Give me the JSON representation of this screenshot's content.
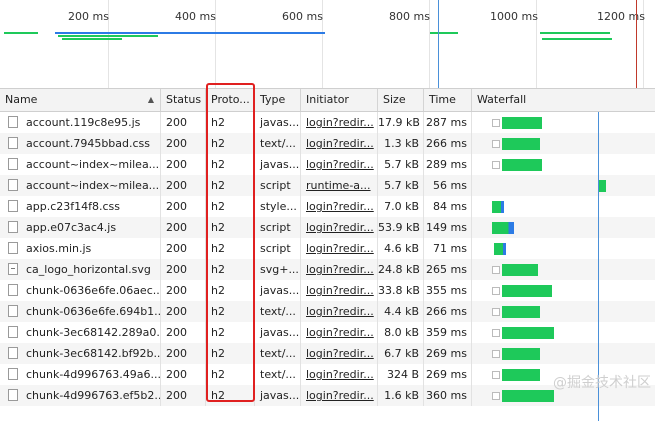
{
  "overview": {
    "ticks": [
      "200 ms",
      "400 ms",
      "600 ms",
      "800 ms",
      "1000 ms",
      "1200 ms"
    ]
  },
  "columns": {
    "name": "Name",
    "status": "Status",
    "protocol": "Proto...",
    "type": "Type",
    "initiator": "Initiator",
    "size": "Size",
    "time": "Time",
    "waterfall": "Waterfall"
  },
  "rows": [
    {
      "name": "account.119c8e95.js",
      "status": "200",
      "protocol": "h2",
      "type": "javas...",
      "initiator": "login?redir...",
      "size": "17.9 kB",
      "time": "287 ms"
    },
    {
      "name": "account.7945bbad.css",
      "status": "200",
      "protocol": "h2",
      "type": "text/...",
      "initiator": "login?redir...",
      "size": "1.3 kB",
      "time": "266 ms"
    },
    {
      "name": "account~index~milea...",
      "status": "200",
      "protocol": "h2",
      "type": "javas...",
      "initiator": "login?redir...",
      "size": "5.7 kB",
      "time": "289 ms"
    },
    {
      "name": "account~index~milea...",
      "status": "200",
      "protocol": "h2",
      "type": "script",
      "initiator": "runtime-a...",
      "size": "5.7 kB",
      "time": "56 ms"
    },
    {
      "name": "app.c23f14f8.css",
      "status": "200",
      "protocol": "h2",
      "type": "style...",
      "initiator": "login?redir...",
      "size": "7.0 kB",
      "time": "84 ms"
    },
    {
      "name": "app.e07c3ac4.js",
      "status": "200",
      "protocol": "h2",
      "type": "script",
      "initiator": "login?redir...",
      "size": "53.9 kB",
      "time": "149 ms"
    },
    {
      "name": "axios.min.js",
      "status": "200",
      "protocol": "h2",
      "type": "script",
      "initiator": "login?redir...",
      "size": "4.6 kB",
      "time": "71 ms"
    },
    {
      "name": "ca_logo_horizontal.svg",
      "status": "200",
      "protocol": "h2",
      "type": "svg+...",
      "initiator": "login?redir...",
      "size": "24.8 kB",
      "time": "265 ms"
    },
    {
      "name": "chunk-0636e6fe.06aec...",
      "status": "200",
      "protocol": "h2",
      "type": "javas...",
      "initiator": "login?redir...",
      "size": "33.8 kB",
      "time": "355 ms"
    },
    {
      "name": "chunk-0636e6fe.694b1...",
      "status": "200",
      "protocol": "h2",
      "type": "text/...",
      "initiator": "login?redir...",
      "size": "4.4 kB",
      "time": "266 ms"
    },
    {
      "name": "chunk-3ec68142.289a0...",
      "status": "200",
      "protocol": "h2",
      "type": "javas...",
      "initiator": "login?redir...",
      "size": "8.0 kB",
      "time": "359 ms"
    },
    {
      "name": "chunk-3ec68142.bf92b...",
      "status": "200",
      "protocol": "h2",
      "type": "text/...",
      "initiator": "login?redir...",
      "size": "6.7 kB",
      "time": "269 ms"
    },
    {
      "name": "chunk-4d996763.49a6...",
      "status": "200",
      "protocol": "h2",
      "type": "text/...",
      "initiator": "login?redir...",
      "size": "324 B",
      "time": "269 ms"
    },
    {
      "name": "chunk-4d996763.ef5b2...",
      "status": "200",
      "protocol": "h2",
      "type": "javas...",
      "initiator": "login?redir...",
      "size": "1.6 kB",
      "time": "360 ms"
    }
  ],
  "watermark": "@掘金技术社区",
  "colors": {
    "bar_green": "#1ec95a",
    "bar_blue": "#2c7be5",
    "highlight_red": "#e02020",
    "dom_line_blue": "#4a90d9",
    "load_line_red": "#c0392b"
  }
}
